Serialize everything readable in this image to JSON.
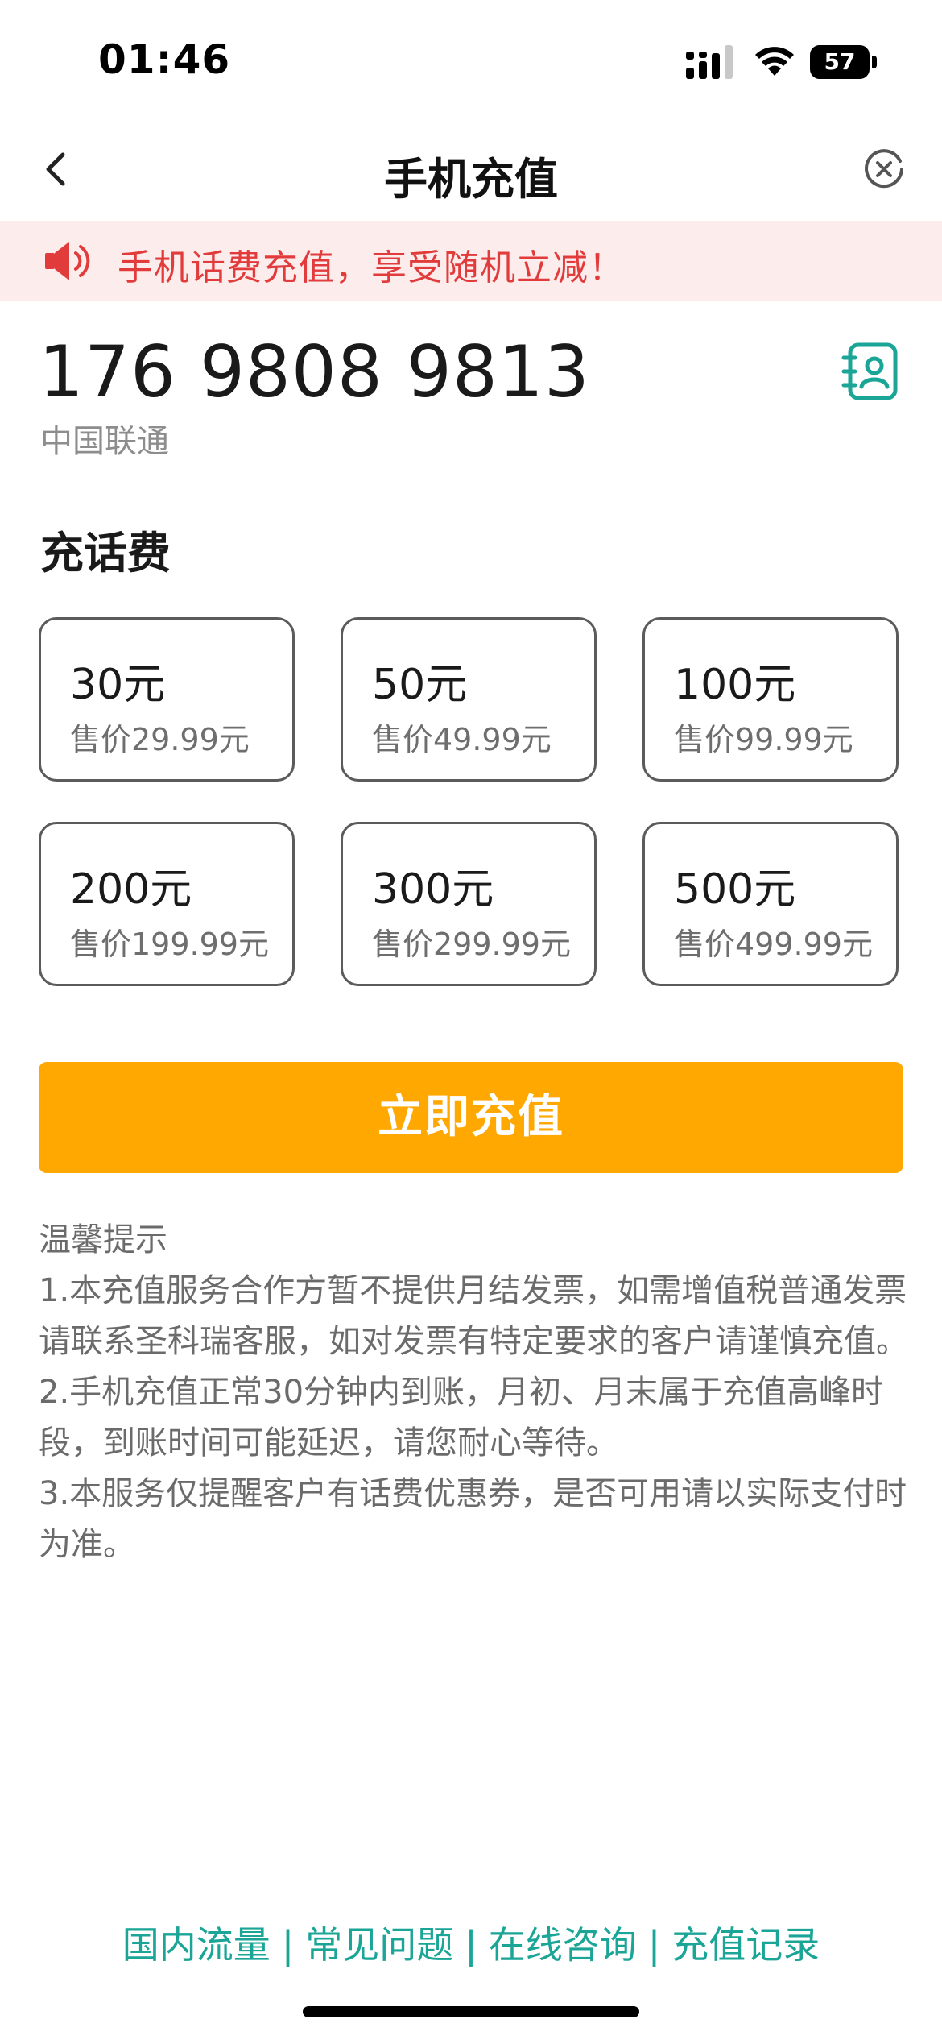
{
  "status_bar": {
    "time": "01:46",
    "battery": "57"
  },
  "header": {
    "title": "手机充值",
    "back_icon": "chevron-left-icon",
    "close_icon": "close-circle-icon"
  },
  "promo": {
    "text": "手机话费充值，享受随机立减！",
    "icon": "speaker-icon",
    "color": "#e23b3b",
    "background": "#fcecec"
  },
  "phone": {
    "number": "176 9808 9813",
    "carrier": "中国联通",
    "contacts_icon": "contacts-book-icon",
    "accent": "#1aa597"
  },
  "section_title": "充话费",
  "amounts": [
    {
      "face": "30元",
      "price": "售价29.99元"
    },
    {
      "face": "50元",
      "price": "售价49.99元"
    },
    {
      "face": "100元",
      "price": "售价99.99元"
    },
    {
      "face": "200元",
      "price": "售价199.99元"
    },
    {
      "face": "300元",
      "price": "售价299.99元"
    },
    {
      "face": "500元",
      "price": "售价499.99元"
    }
  ],
  "submit": {
    "label": "立即充值",
    "color": "#ffa801"
  },
  "tips": {
    "title": "温馨提示",
    "lines": [
      "1.本充值服务合作方暂不提供月结发票，如需增值税普通发票请联系圣科瑞客服，如对发票有特定要求的客户请谨慎充值。",
      "2.手机充值正常30分钟内到账，月初、月末属于充值高峰时段，到账时间可能延迟，请您耐心等待。",
      "3.本服务仅提醒客户有话费优惠券，是否可用请以实际支付时为准。"
    ]
  },
  "footer": {
    "links": [
      "国内流量",
      "常见问题",
      "在线咨询",
      "充值记录"
    ],
    "separator": "|"
  }
}
